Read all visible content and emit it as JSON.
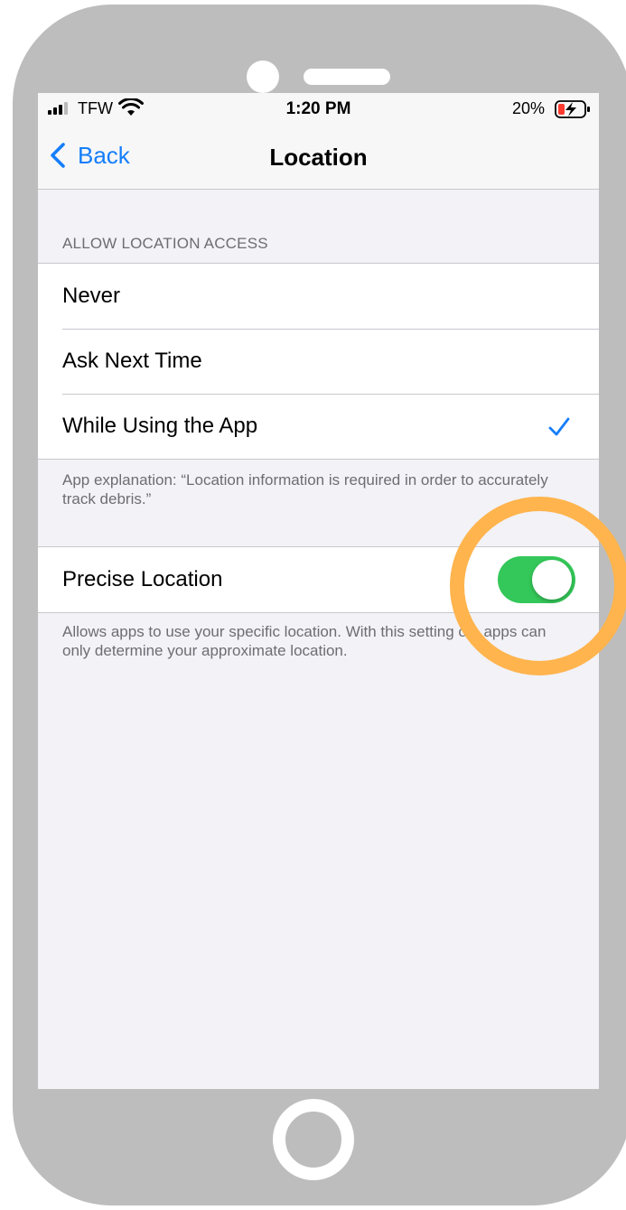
{
  "status_bar": {
    "carrier": "TFW",
    "time": "1:20 PM",
    "battery_percent": "20%",
    "icons": [
      "signal-icon",
      "wifi-icon",
      "battery-charging-icon"
    ]
  },
  "nav_bar": {
    "back_label": "Back",
    "title": "Location"
  },
  "access_section": {
    "header": "ALLOW LOCATION ACCESS",
    "options": [
      {
        "label": "Never",
        "selected": false
      },
      {
        "label": "Ask Next Time",
        "selected": false
      },
      {
        "label": "While Using the App",
        "selected": true
      }
    ],
    "footer": "App explanation: “Location information is required in order to accurately track debris.”"
  },
  "precise_section": {
    "label": "Precise Location",
    "enabled": true,
    "footer": "Allows apps to use your specific location. With this setting off, apps can only determine your approximate location."
  },
  "colors": {
    "accent_blue": "#157efb",
    "toggle_on_green": "#34c759",
    "highlight_orange": "#ffb44d",
    "battery_low_red": "#ff3b30",
    "device_frame_gray": "#bdbdbd"
  }
}
